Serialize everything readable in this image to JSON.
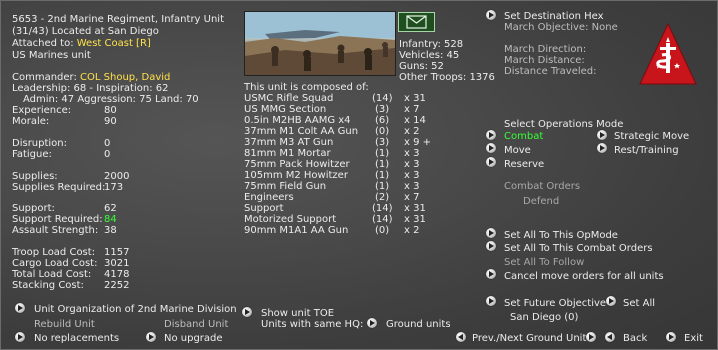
{
  "unit": {
    "title": "5653 - 2nd Marine Regiment, Infantry Unit",
    "location": "(31/43) Located at San Diego",
    "attached_prefix": "Attached to:",
    "attached_value": "West Coast [R]",
    "nation": "US Marines unit"
  },
  "commander": {
    "label": "Commander:",
    "name": "COL Shoup, David",
    "leadership": "Leadership: 68 - Inspiration: 62",
    "admin_line": "Admin: 47  Aggression: 75  Land: 70"
  },
  "stats": [
    {
      "label": "Experience:",
      "value": "80"
    },
    {
      "label": "Morale:",
      "value": "90"
    },
    {
      "label": "Disruption:",
      "value": "0"
    },
    {
      "label": "Fatigue:",
      "value": "0"
    },
    {
      "label": "Supplies:",
      "value": "2000"
    },
    {
      "label": "Supplies Required:",
      "value": "173"
    },
    {
      "label": "Support:",
      "value": "62"
    },
    {
      "label": "Support Required:",
      "value": "84"
    },
    {
      "label": "Assault Strength:",
      "value": "38"
    },
    {
      "label": "Troop Load Cost:",
      "value": "1157"
    },
    {
      "label": "Cargo Load Cost:",
      "value": "3021"
    },
    {
      "label": "Total Load Cost:",
      "value": "4178"
    },
    {
      "label": "Stacking Cost:",
      "value": "2252"
    }
  ],
  "counts": {
    "infantry": "Infantry: 528",
    "vehicles": "Vehicles: 45",
    "guns": "Guns: 52",
    "other": "Other Troops: 1376"
  },
  "composition": {
    "header": "This unit is composed of:",
    "items": [
      {
        "name": "USMC Rifle Squad",
        "count": "(14)",
        "qty": "x 31"
      },
      {
        "name": "US MMG Section",
        "count": "(3)",
        "qty": "x 7"
      },
      {
        "name": "0.5in M2HB AAMG x4",
        "count": "(6)",
        "qty": "x 14"
      },
      {
        "name": "37mm M1 Colt AA Gun",
        "count": "(0)",
        "qty": "x 2"
      },
      {
        "name": "37mm M3 AT Gun",
        "count": "(3)",
        "qty": "x 9 +"
      },
      {
        "name": "81mm M1 Mortar",
        "count": "(1)",
        "qty": "x 3"
      },
      {
        "name": "75mm Pack Howitzer",
        "count": "(1)",
        "qty": "x 3"
      },
      {
        "name": "105mm M2 Howitzer",
        "count": "(1)",
        "qty": "x 3"
      },
      {
        "name": "75mm Field Gun",
        "count": "(1)",
        "qty": "x 3"
      },
      {
        "name": "Engineers",
        "count": "(2)",
        "qty": "x 7"
      },
      {
        "name": "Support",
        "count": "(14)",
        "qty": "x 31"
      },
      {
        "name": "Motorized Support",
        "count": "(14)",
        "qty": "x 31"
      },
      {
        "name": "90mm M1A1 AA Gun",
        "count": "(0)",
        "qty": "x 2"
      }
    ]
  },
  "march": {
    "set_destination": "Set Destination Hex",
    "objective": "March Objective: None",
    "direction": "March Direction:",
    "distance": "March Distance:",
    "traveled": "Distance Traveled:"
  },
  "ops": {
    "header": "Select Operations Mode",
    "combat": "Combat",
    "move": "Move",
    "reserve": "Reserve",
    "strategic": "Strategic Move",
    "rest": "Rest/Training",
    "combat_orders": "Combat Orders",
    "defend": "Defend"
  },
  "actions": {
    "set_all_opmode": "Set All To This OpMode",
    "set_all_combat": "Set All To This Combat Orders",
    "set_all_follow": "Set All To Follow",
    "cancel_moves": "Cancel move orders for all units",
    "future_objective": "Set Future Objective",
    "set_all": "Set All",
    "future_location": "San Diego (0)"
  },
  "bottom": {
    "unit_org": "Unit Organization of 2nd Marine Division",
    "rebuild": "Rebuild Unit",
    "disband": "Disband Unit",
    "no_replacements": "No replacements",
    "no_upgrade": "No upgrade",
    "show_toe": "Show unit TOE",
    "same_hq": "Units with same HQ:",
    "ground_units": "Ground units",
    "prev_next": "Prev./Next Ground Unit",
    "back": "Back",
    "exit": "Exit"
  },
  "colors": {
    "highlight_yellow": "#ffe24a",
    "highlight_green": "#35ff35",
    "emblem_red": "#c8141b"
  }
}
